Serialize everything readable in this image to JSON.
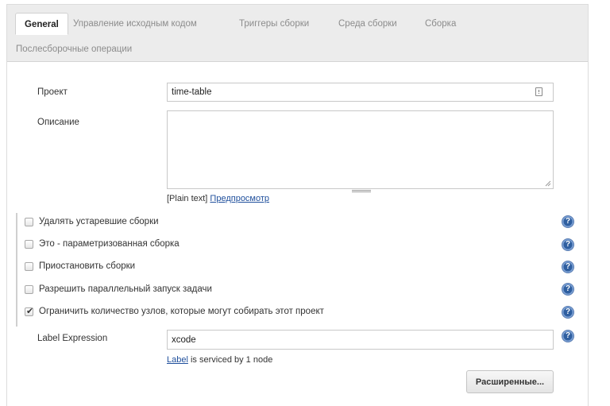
{
  "tabs": [
    {
      "label": "General",
      "active": true
    },
    {
      "label": "Управление исходным кодом",
      "active": false
    },
    {
      "label": "Триггеры сборки",
      "active": false
    },
    {
      "label": "Среда сборки",
      "active": false
    },
    {
      "label": "Сборка",
      "active": false
    },
    {
      "label": "Послесборочные операции",
      "active": false
    }
  ],
  "project": {
    "label": "Проект",
    "value": "time-table"
  },
  "description": {
    "label": "Описание",
    "value": "",
    "format_prefix": "[Plain text]",
    "preview_link": "Предпросмотр"
  },
  "options": [
    {
      "label": "Удалять устаревшие сборки",
      "checked": false
    },
    {
      "label": "Это - параметризованная сборка",
      "checked": false
    },
    {
      "label": "Приостановить сборки",
      "checked": false
    },
    {
      "label": "Разрешить параллельный запуск задачи",
      "checked": false
    },
    {
      "label": "Ограничить количество узлов, которые могут собирать этот проект",
      "checked": true
    }
  ],
  "label_expression": {
    "label": "Label Expression",
    "value": "xcode",
    "hint_link": "Label",
    "hint_text": " is serviced by 1 node"
  },
  "advanced_button": "Расширенные...",
  "help_icon_glyph": "?",
  "colors": {
    "help": "#2f5fa0",
    "link": "#1f4f9c",
    "tabbar": "#ececec"
  }
}
